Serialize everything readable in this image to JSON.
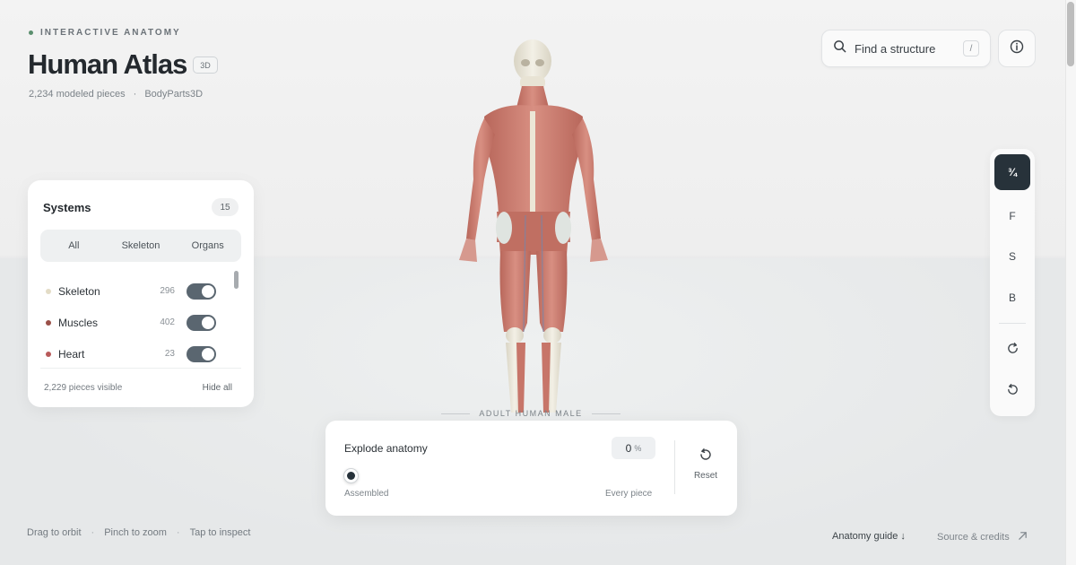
{
  "header": {
    "eyebrow": "INTERACTIVE ANATOMY",
    "title": "Human Atlas",
    "badge": "3D",
    "pieces": "2,234 modeled pieces",
    "separator": "·",
    "source": "BodyParts3D"
  },
  "search": {
    "placeholder": "Find a structure",
    "shortcut": "/",
    "icon": "search-icon"
  },
  "info": {
    "icon": "info-icon"
  },
  "systems": {
    "title": "Systems",
    "count": "15",
    "filters": [
      "All",
      "Skeleton",
      "Organs"
    ],
    "items": [
      {
        "name": "Skeleton",
        "count": "296",
        "color": "#e3dcc6",
        "on": true
      },
      {
        "name": "Muscles",
        "count": "402",
        "color": "#9a5048",
        "on": true
      },
      {
        "name": "Heart",
        "count": "23",
        "color": "#b85a5a",
        "on": true
      }
    ],
    "visible": "2,229 pieces visible",
    "hide_all": "Hide all"
  },
  "views": {
    "buttons": [
      {
        "label": "¾",
        "active": true
      },
      {
        "label": "F",
        "active": false
      },
      {
        "label": "S",
        "active": false
      },
      {
        "label": "B",
        "active": false
      }
    ],
    "actions": [
      "rotate-cw-icon",
      "undo-icon"
    ]
  },
  "model": {
    "caption": "ADULT HUMAN MALE"
  },
  "explode": {
    "label": "Explode anatomy",
    "value": "0",
    "unit": "%",
    "fraction": 0,
    "min_label": "Assembled",
    "max_label": "Every piece",
    "reset": "Reset"
  },
  "footer": {
    "hints": [
      "Drag to orbit",
      "Pinch to zoom",
      "Tap to inspect"
    ],
    "hint_separator": "·",
    "guide": "Anatomy guide ↓",
    "credits": "Source & credits"
  },
  "colors": {
    "accent_dark": "#27323a",
    "toggle_on": "#5a6670",
    "status_dot": "#5b8f6e"
  }
}
